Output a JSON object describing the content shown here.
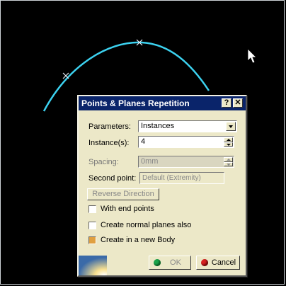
{
  "dialog": {
    "title": "Points & Planes Repetition",
    "help_icon": "?",
    "close_icon": "✕",
    "parameters_label": "Parameters:",
    "parameters_value": "Instances",
    "instances_label": "Instance(s):",
    "instances_value": "4",
    "spacing_label": "Spacing:",
    "spacing_value": "0mm",
    "second_point_label": "Second point:",
    "second_point_value": "Default (Extremity)",
    "reverse_direction_label": "Reverse Direction",
    "with_end_points_label": "With end points",
    "with_end_points_checked": false,
    "create_normal_planes_label": "Create normal planes also",
    "create_normal_planes_checked": false,
    "create_in_new_body_label": "Create in a new Body",
    "create_in_new_body_checked": true,
    "ok_label": "OK",
    "cancel_label": "Cancel"
  },
  "colors": {
    "curve": "#3cd2f0",
    "titlebar": "#0a246a",
    "dialog_bg": "#ece8c8",
    "ok_icon": "#1aa34a",
    "cancel_icon": "#d62020"
  }
}
